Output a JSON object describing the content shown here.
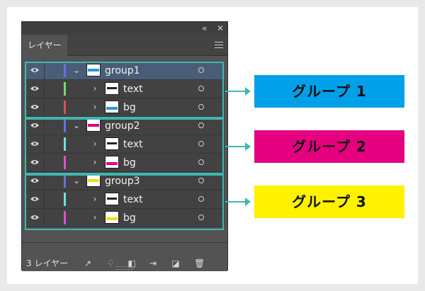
{
  "panel": {
    "collapse_icon": "double-chevron-left-icon",
    "close_icon": "close-icon",
    "tab_label": "レイヤー",
    "menu_icon": "hamburger-menu-icon",
    "footer": {
      "layer_count": "3 レイヤー",
      "icons": [
        "export-icon",
        "search-icon",
        "clipping-mask-icon",
        "move-to-layer-icon",
        "new-layer-icon",
        "trash-icon"
      ]
    }
  },
  "layers": [
    {
      "name": "group1",
      "expanded": true,
      "level": 0,
      "color": "#6a70e0",
      "thumb_band": "#1e9be0",
      "selected": true
    },
    {
      "name": "text",
      "expanded": false,
      "level": 1,
      "color": "#6ee06a",
      "thumb_band": "text",
      "selected": false
    },
    {
      "name": "bg",
      "expanded": false,
      "level": 1,
      "color": "#e05050",
      "thumb_band": "#1e9be0",
      "selected": false
    },
    {
      "name": "group2",
      "expanded": true,
      "level": 0,
      "color": "#6a70e0",
      "thumb_band": "#e0007f",
      "selected": false
    },
    {
      "name": "text",
      "expanded": false,
      "level": 1,
      "color": "#6ee0e0",
      "thumb_band": "text",
      "selected": false
    },
    {
      "name": "bg",
      "expanded": false,
      "level": 1,
      "color": "#e050d0",
      "thumb_band": "#e0007f",
      "selected": false
    },
    {
      "name": "group3",
      "expanded": true,
      "level": 0,
      "color": "#6a70e0",
      "thumb_band": "#f0e000",
      "selected": false
    },
    {
      "name": "text",
      "expanded": false,
      "level": 1,
      "color": "#6ee0e0",
      "thumb_band": "text",
      "selected": false
    },
    {
      "name": "bg",
      "expanded": false,
      "level": 1,
      "color": "#e050d0",
      "thumb_band": "#f0e000",
      "selected": false
    }
  ],
  "callouts": [
    {
      "label": "グループ 1",
      "color": "#00a0e9"
    },
    {
      "label": "グループ 2",
      "color": "#e4007f"
    },
    {
      "label": "グループ 3",
      "color": "#fff100"
    }
  ],
  "accent_color": "#3fb8b0"
}
